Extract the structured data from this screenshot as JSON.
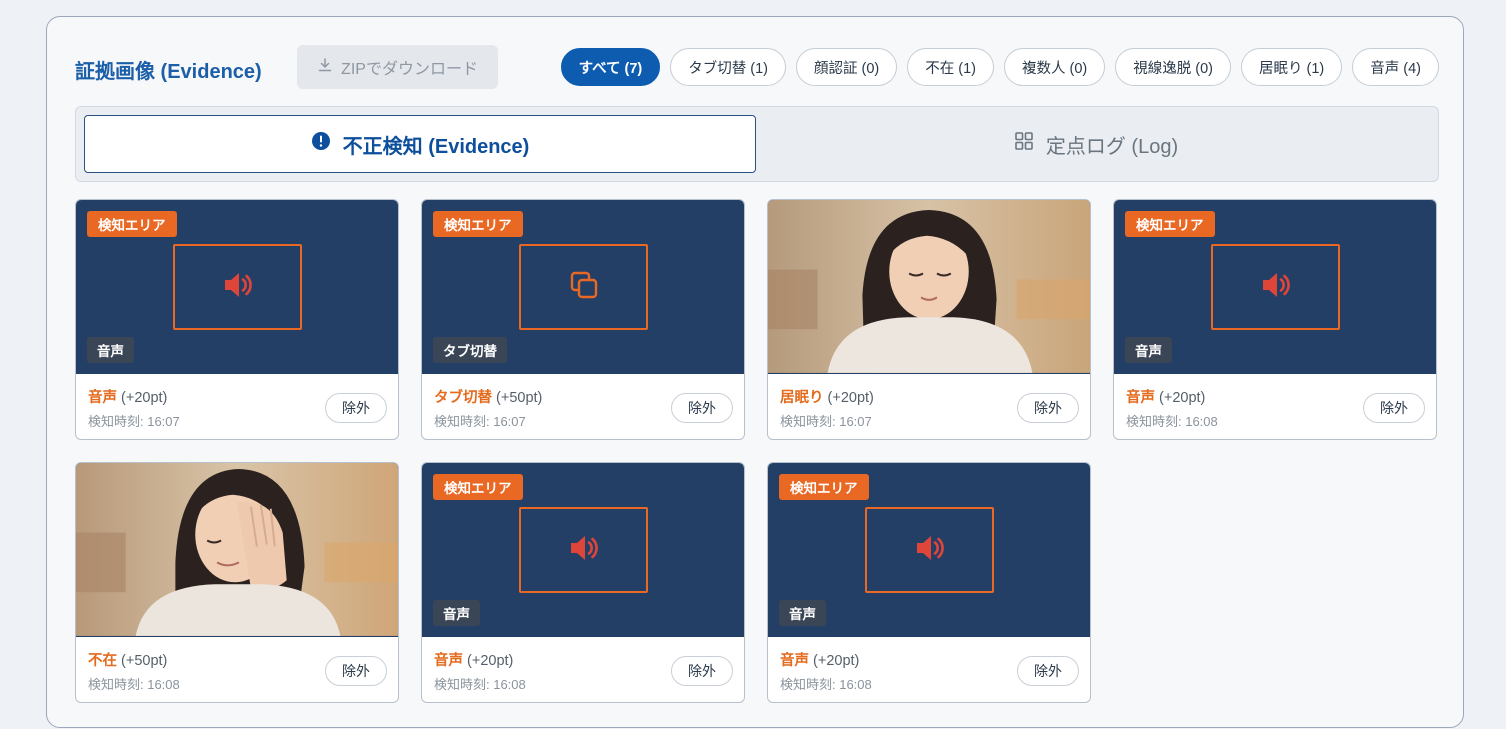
{
  "header": {
    "title": "証拠画像 (Evidence)",
    "zip_button": "ZIPでダウンロード"
  },
  "filters": [
    {
      "label": "すべて (7)",
      "active": true
    },
    {
      "label": "タブ切替 (1)",
      "active": false
    },
    {
      "label": "顔認証 (0)",
      "active": false
    },
    {
      "label": "不在 (1)",
      "active": false
    },
    {
      "label": "複数人 (0)",
      "active": false
    },
    {
      "label": "視線逸脱 (0)",
      "active": false
    },
    {
      "label": "居眠り (1)",
      "active": false
    },
    {
      "label": "音声 (4)",
      "active": false
    }
  ],
  "tabs": {
    "evidence": "不正検知 (Evidence)",
    "log": "定点ログ (Log)"
  },
  "colors": {
    "accent": "#0d5cb0",
    "alert_orange": "#e86824",
    "thumb_navy": "#243f66",
    "speaker_red": "#e0453a"
  },
  "cards": [
    {
      "area_badge": "検知エリア",
      "thumb_tag": "音声",
      "icon": "speaker-icon",
      "kind": "音声",
      "points": "(+20pt)",
      "time": "検知時刻: 16:07",
      "exclude": "除外"
    },
    {
      "area_badge": "検知エリア",
      "thumb_tag": "タブ切替",
      "icon": "copy-icon",
      "kind": "タブ切替",
      "points": "(+50pt)",
      "time": "検知時刻: 16:07",
      "exclude": "除外"
    },
    {
      "area_badge": "",
      "thumb_tag": "",
      "icon": "photo-sleeping",
      "kind": "居眠り",
      "points": "(+20pt)",
      "time": "検知時刻: 16:07",
      "exclude": "除外"
    },
    {
      "area_badge": "検知エリア",
      "thumb_tag": "音声",
      "icon": "speaker-icon",
      "kind": "音声",
      "points": "(+20pt)",
      "time": "検知時刻: 16:08",
      "exclude": "除外"
    },
    {
      "area_badge": "",
      "thumb_tag": "",
      "icon": "photo-covering-face",
      "kind": "不在",
      "points": "(+50pt)",
      "time": "検知時刻: 16:08",
      "exclude": "除外"
    },
    {
      "area_badge": "検知エリア",
      "thumb_tag": "音声",
      "icon": "speaker-icon",
      "kind": "音声",
      "points": "(+20pt)",
      "time": "検知時刻: 16:08",
      "exclude": "除外"
    },
    {
      "area_badge": "検知エリア",
      "thumb_tag": "音声",
      "icon": "speaker-icon",
      "kind": "音声",
      "points": "(+20pt)",
      "time": "検知時刻: 16:08",
      "exclude": "除外"
    }
  ]
}
